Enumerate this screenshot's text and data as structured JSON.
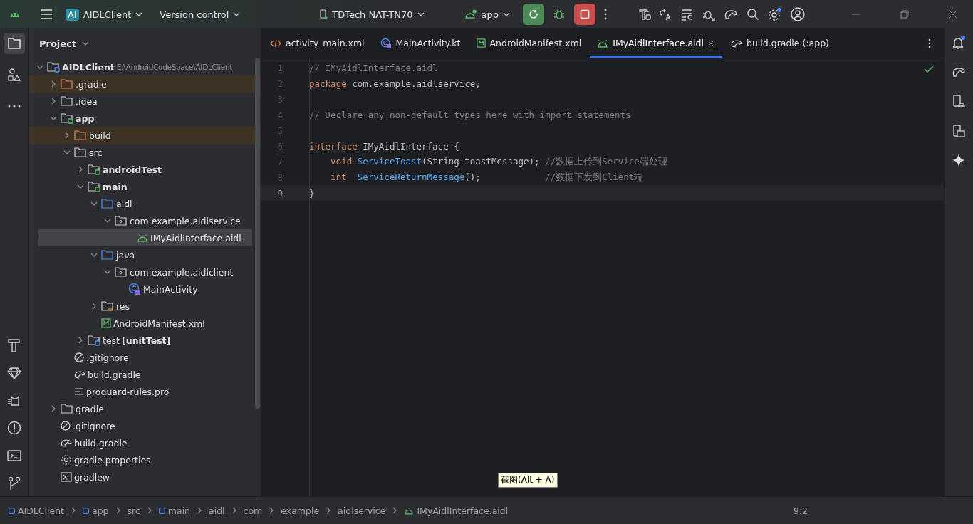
{
  "title_bar": {
    "project_badge": "AI",
    "project_name": "AIDLClient",
    "vcs": "Version control",
    "device": "TDTech NAT-TN70",
    "run_config": "app"
  },
  "left_tools": [
    {
      "kind": "project",
      "selected": true
    },
    {
      "kind": "structure",
      "selected": false
    },
    {
      "kind": "more",
      "selected": false
    }
  ],
  "left_tools_bottom": [
    {
      "kind": "build"
    },
    {
      "kind": "gem"
    },
    {
      "kind": "logcat"
    },
    {
      "kind": "problems"
    },
    {
      "kind": "terminal"
    },
    {
      "kind": "git"
    }
  ],
  "project_panel": {
    "title": "Project",
    "tree": [
      {
        "label": "AIDLClient",
        "hint": "E:\\AndroidCodeSpace\\AIDLClient",
        "kind": "module",
        "bold": true,
        "expanded": true,
        "excluded": false,
        "selected": false,
        "children": [
          {
            "label": ".gradle",
            "kind": "folder",
            "expanded": false,
            "excluded": true,
            "selected": false
          },
          {
            "label": ".idea",
            "kind": "folder",
            "expanded": false,
            "excluded": false,
            "selected": false
          },
          {
            "label": "app",
            "kind": "source-module",
            "bold": true,
            "expanded": true,
            "excluded": false,
            "selected": false,
            "children": [
              {
                "label": "build",
                "kind": "folder",
                "expanded": false,
                "excluded": true,
                "selected": false
              },
              {
                "label": "src",
                "kind": "folder",
                "expanded": true,
                "excluded": false,
                "selected": false,
                "children": [
                  {
                    "label": "androidTest",
                    "kind": "source-module",
                    "bold": true,
                    "expanded": false,
                    "excluded": false,
                    "selected": false
                  },
                  {
                    "label": "main",
                    "kind": "source-module",
                    "bold": true,
                    "expanded": true,
                    "excluded": false,
                    "selected": false,
                    "children": [
                      {
                        "label": "aidl",
                        "kind": "source-folder",
                        "expanded": true,
                        "excluded": false,
                        "selected": false,
                        "children": [
                          {
                            "label": "com.example.aidlservice",
                            "kind": "package",
                            "expanded": true,
                            "excluded": false,
                            "selected": false,
                            "children": [
                              {
                                "label": "IMyAidlInterface.aidl",
                                "kind": "aidl",
                                "excluded": false,
                                "selected": true
                              }
                            ]
                          }
                        ]
                      },
                      {
                        "label": "java",
                        "kind": "source-folder",
                        "expanded": true,
                        "excluded": false,
                        "selected": false,
                        "children": [
                          {
                            "label": "com.example.aidlclient",
                            "kind": "package",
                            "expanded": true,
                            "excluded": false,
                            "selected": false,
                            "children": [
                              {
                                "label": "MainActivity",
                                "kind": "kotlin",
                                "excluded": false,
                                "selected": false
                              }
                            ]
                          }
                        ]
                      },
                      {
                        "label": "res",
                        "kind": "res",
                        "expanded": false,
                        "excluded": false,
                        "selected": false
                      },
                      {
                        "label": "AndroidManifest.xml",
                        "kind": "manifest",
                        "excluded": false,
                        "selected": false
                      }
                    ]
                  },
                  {
                    "label": "test",
                    "suffix": "[unitTest]",
                    "kind": "test-module",
                    "expanded": false,
                    "excluded": false,
                    "selected": false
                  }
                ]
              },
              {
                "label": ".gitignore",
                "kind": "ignore",
                "excluded": false,
                "selected": false
              },
              {
                "label": "build.gradle",
                "kind": "gradle",
                "excluded": false,
                "selected": false
              },
              {
                "label": "proguard-rules.pro",
                "kind": "text",
                "excluded": false,
                "selected": false
              }
            ]
          },
          {
            "label": "gradle",
            "kind": "folder",
            "expanded": false,
            "excluded": false,
            "selected": false
          },
          {
            "label": ".gitignore",
            "kind": "ignore",
            "excluded": false,
            "selected": false
          },
          {
            "label": "build.gradle",
            "kind": "gradle",
            "excluded": false,
            "selected": false
          },
          {
            "label": "gradle.properties",
            "kind": "settings",
            "excluded": false,
            "selected": false
          },
          {
            "label": "gradlew",
            "kind": "script",
            "excluded": false,
            "selected": false
          }
        ]
      }
    ]
  },
  "editor_tabs": [
    {
      "label": "activity_main.xml",
      "kind": "xml",
      "selected": false
    },
    {
      "label": "MainActivity.kt",
      "kind": "kotlin",
      "selected": false
    },
    {
      "label": "AndroidManifest.xml",
      "kind": "manifest",
      "selected": false
    },
    {
      "label": "IMyAidlInterface.aidl",
      "kind": "aidl",
      "selected": true
    },
    {
      "label": "build.gradle (:app)",
      "kind": "gradle",
      "selected": false
    }
  ],
  "code_lines": [
    {
      "number": "1",
      "current": false,
      "tokens": [
        {
          "text": "// IMyAidlInterface.aidl",
          "kind": "comment"
        }
      ]
    },
    {
      "number": "2",
      "current": false,
      "tokens": [
        {
          "text": "package",
          "kind": "keyword"
        },
        {
          "text": " com.example.aidlservice;",
          "kind": "plain"
        }
      ]
    },
    {
      "number": "3",
      "current": false
    },
    {
      "number": "4",
      "current": false,
      "tokens": [
        {
          "text": "// Declare any non-default types here with import statements",
          "kind": "comment"
        }
      ]
    },
    {
      "number": "5",
      "current": false
    },
    {
      "number": "6",
      "current": false,
      "tokens": [
        {
          "text": "interface",
          "kind": "keyword"
        },
        {
          "text": " IMyAidlInterface {",
          "kind": "plain"
        }
      ]
    },
    {
      "number": "7",
      "current": false,
      "tokens": [
        {
          "text": "    void",
          "kind": "keyword"
        },
        {
          "text": " ServiceToast",
          "kind": "method"
        },
        {
          "text": "(String toastMessage);",
          "kind": "plain"
        },
        {
          "text": " //数据上传到Service端处理",
          "kind": "comment"
        }
      ]
    },
    {
      "number": "8",
      "current": false,
      "tokens": [
        {
          "text": "    int",
          "kind": "keyword"
        },
        {
          "text": "  ServiceReturnMessage",
          "kind": "method"
        },
        {
          "text": "();",
          "kind": "plain"
        },
        {
          "text": "            //数据下发到Client端",
          "kind": "comment"
        }
      ]
    },
    {
      "number": "9",
      "current": true,
      "tokens": [
        {
          "text": "}",
          "kind": "plain"
        }
      ]
    }
  ],
  "tooltip": "截图(Alt + A)",
  "right_tools": [
    {
      "kind": "bell"
    },
    {
      "kind": "gradle"
    },
    {
      "kind": "device"
    },
    {
      "kind": "mirror"
    },
    {
      "kind": "sparkle"
    }
  ],
  "breadcrumbs": [
    {
      "label": "AIDLClient",
      "kind": "module"
    },
    {
      "label": "app",
      "kind": "module"
    },
    {
      "label": "src",
      "kind": "plain"
    },
    {
      "label": "main",
      "kind": "module"
    },
    {
      "label": "aidl",
      "kind": "plain"
    },
    {
      "label": "com",
      "kind": "plain"
    },
    {
      "label": "example",
      "kind": "plain"
    },
    {
      "label": "aidlservice",
      "kind": "plain"
    },
    {
      "label": "IMyAidlInterface.aidl",
      "kind": "aidl"
    }
  ],
  "status": {
    "caret": "9:2"
  }
}
